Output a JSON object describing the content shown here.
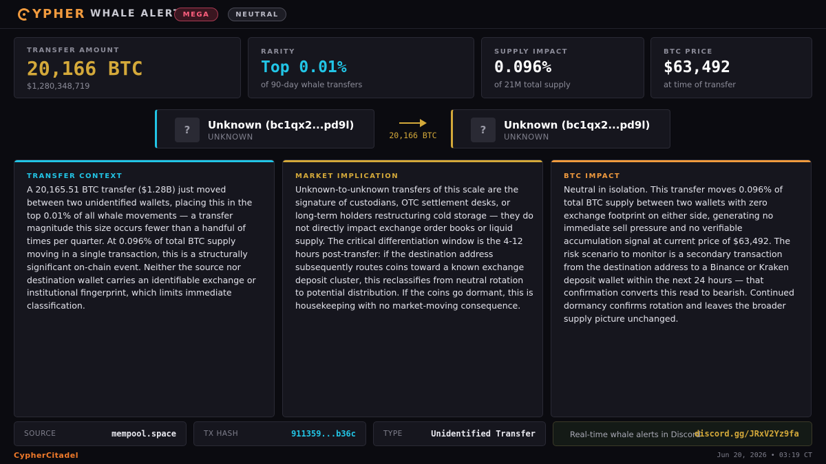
{
  "header": {
    "logo_letters": "YPHER",
    "title": "WHALE ALERT",
    "badges": [
      "MEGA",
      "NEUTRAL"
    ],
    "accent_color": "#f09a3e"
  },
  "stats": [
    {
      "label": "TRANSFER AMOUNT",
      "value": "20,166 BTC",
      "sub": "$1,280,348,719",
      "color": "#d4a93a"
    },
    {
      "label": "RARITY",
      "value": "Top 0.01%",
      "sub": "of 90-day whale transfers",
      "color": "#22c5e6"
    },
    {
      "label": "SUPPLY IMPACT",
      "value": "0.096%",
      "sub": "of 21M total supply",
      "color": "#ffffff"
    },
    {
      "label": "BTC PRICE",
      "value": "$63,492",
      "sub": "at time of transfer",
      "color": "#ffffff"
    }
  ],
  "flow": {
    "from": {
      "name": "Unknown (bc1qx2...pd9l)",
      "type": "UNKNOWN",
      "icon": "?"
    },
    "to": {
      "name": "Unknown (bc1qx2...pd9l)",
      "type": "UNKNOWN",
      "icon": "?"
    },
    "amount": "20,166 BTC"
  },
  "panels": [
    {
      "title": "TRANSFER CONTEXT",
      "color": "#22c5e6",
      "body": "A 20,165.51 BTC transfer ($1.28B) just moved between two unidentified wallets, placing this in the top 0.01% of all whale movements — a transfer magnitude this size occurs fewer than a handful of times per quarter. At 0.096% of total BTC supply moving in a single transaction, this is a structurally significant on-chain event. Neither the source nor destination wallet carries an identifiable exchange or institutional fingerprint, which limits immediate classification."
    },
    {
      "title": "MARKET IMPLICATION",
      "color": "#d4a93a",
      "body": "Unknown-to-unknown transfers of this scale are the signature of custodians, OTC settlement desks, or long-term holders restructuring cold storage — they do not directly impact exchange order books or liquid supply. The critical differentiation window is the 4-12 hours post-transfer: if the destination address subsequently routes coins toward a known exchange deposit cluster, this reclassifies from neutral rotation to potential distribution. If the coins go dormant, this is housekeeping with no market-moving consequence."
    },
    {
      "title": "BTC IMPACT",
      "color": "#f09a3e",
      "body": "Neutral in isolation. This transfer moves 0.096% of total BTC supply between two wallets with zero exchange footprint on either side, generating no immediate sell pressure and no verifiable accumulation signal at current price of $63,492. The risk scenario to monitor is a secondary transaction from the destination address to a Binance or Kraken deposit wallet within the next 24 hours — that confirmation converts this read to bearish. Continued dormancy confirms rotation and leaves the broader supply picture unchanged."
    }
  ],
  "footer": {
    "source_label": "SOURCE",
    "source_value": "mempool.space",
    "hash_label": "TX HASH",
    "hash_value": "911359...b36c",
    "type_label": "TYPE",
    "type_value": "Unidentified Transfer",
    "discord_text": "Real-time whale alerts in Discord",
    "discord_link": "discord.gg/JRxV2Yz9fa",
    "brand": "CypherCitadel",
    "date": "Jun 20, 2026 • 03:19 CT"
  }
}
